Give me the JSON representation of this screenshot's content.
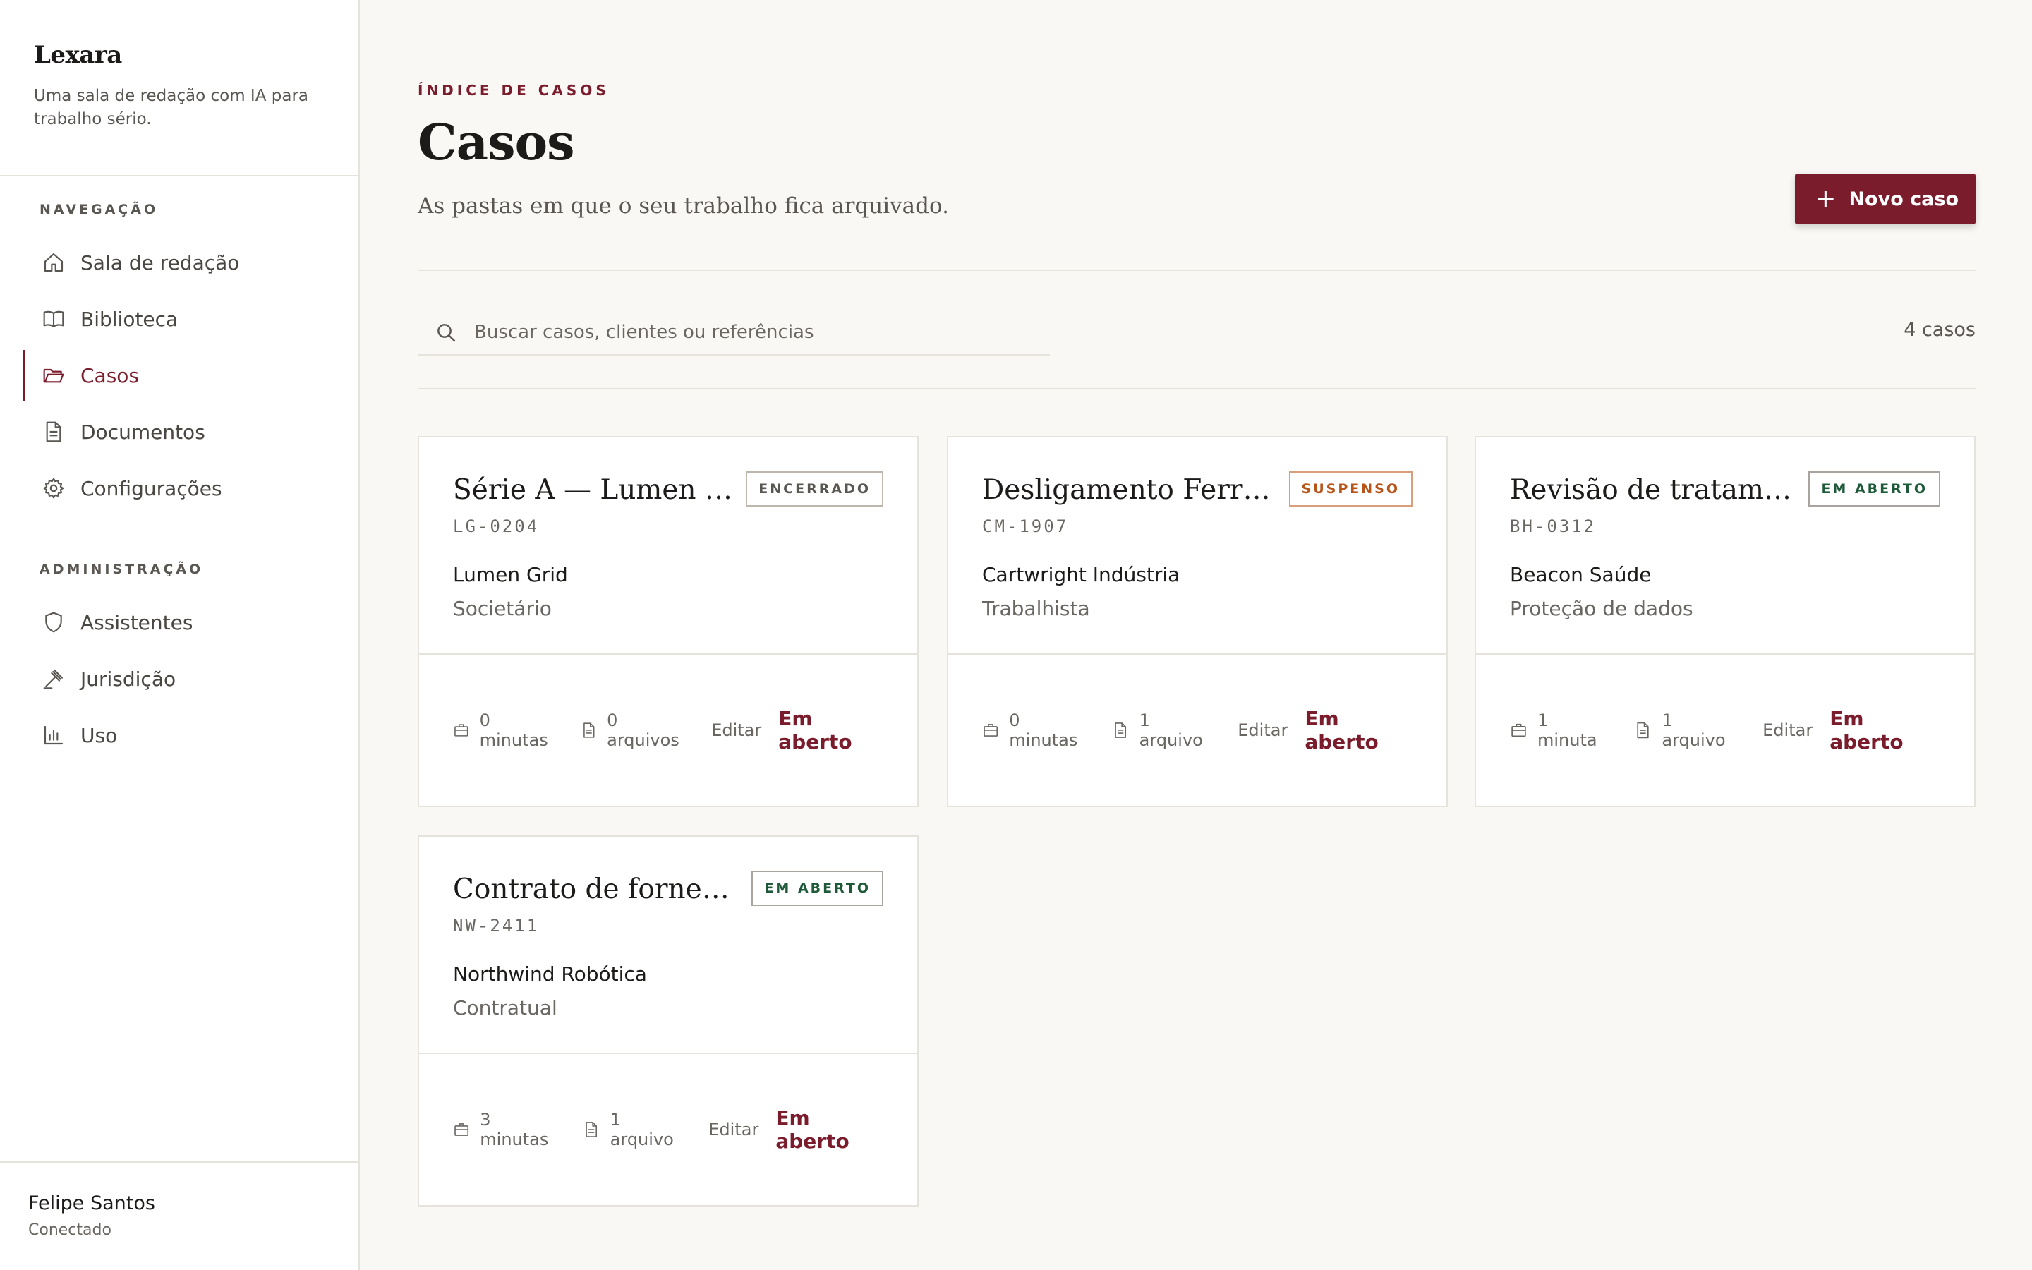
{
  "brand": {
    "name": "Lexara",
    "tagline": "Uma sala de redação com IA para trabalho sério."
  },
  "sidebar": {
    "nav_section": "NAVEGAÇÃO",
    "nav_items": [
      {
        "label": "Sala de redação",
        "icon": "home-icon",
        "active": false
      },
      {
        "label": "Biblioteca",
        "icon": "book-icon",
        "active": false
      },
      {
        "label": "Casos",
        "icon": "folder-icon",
        "active": true
      },
      {
        "label": "Documentos",
        "icon": "document-icon",
        "active": false
      },
      {
        "label": "Configurações",
        "icon": "gear-icon",
        "active": false
      }
    ],
    "admin_section": "ADMINISTRAÇÃO",
    "admin_items": [
      {
        "label": "Assistentes",
        "icon": "shield-icon"
      },
      {
        "label": "Jurisdição",
        "icon": "gavel-icon"
      },
      {
        "label": "Uso",
        "icon": "bar-chart-icon"
      }
    ],
    "user": {
      "name": "Felipe Santos",
      "status": "Conectado"
    }
  },
  "header": {
    "eyebrow": "ÍNDICE DE CASOS",
    "title": "Casos",
    "subtitle": "As pastas em que o seu trabalho fica arquivado.",
    "new_button": "Novo caso"
  },
  "search": {
    "placeholder": "Buscar casos, clientes ou referências",
    "count": "4 casos"
  },
  "colors": {
    "accent": "#7a1c2c",
    "background": "#faf8f5",
    "badge_suspended": "#b85418",
    "badge_open": "#1e5a3a"
  },
  "cases": [
    {
      "title": "Série A — Lumen G...",
      "badge": "ENCERRADO",
      "badge_type": "closed",
      "ref": "LG-0204",
      "client": "Lumen Grid",
      "area": "Societário",
      "minutes": "0 minutas",
      "files": "0 arquivos",
      "edit": "Editar",
      "status": "Em aberto"
    },
    {
      "title": "Desligamento Ferrari",
      "badge": "SUSPENSO",
      "badge_type": "suspended",
      "ref": "CM-1907",
      "client": "Cartwright Indústria",
      "area": "Trabalhista",
      "minutes": "0 minutas",
      "files": "1 arquivo",
      "edit": "Editar",
      "status": "Em aberto"
    },
    {
      "title": "Revisão de tratame...",
      "badge": "EM ABERTO",
      "badge_type": "open",
      "ref": "BH-0312",
      "client": "Beacon Saúde",
      "area": "Proteção de dados",
      "minutes": "1 minuta",
      "files": "1 arquivo",
      "edit": "Editar",
      "status": "Em aberto"
    },
    {
      "title": "Contrato de forneci...",
      "badge": "EM ABERTO",
      "badge_type": "open",
      "ref": "NW-2411",
      "client": "Northwind Robótica",
      "area": "Contratual",
      "minutes": "3 minutas",
      "files": "1 arquivo",
      "edit": "Editar",
      "status": "Em aberto"
    }
  ]
}
